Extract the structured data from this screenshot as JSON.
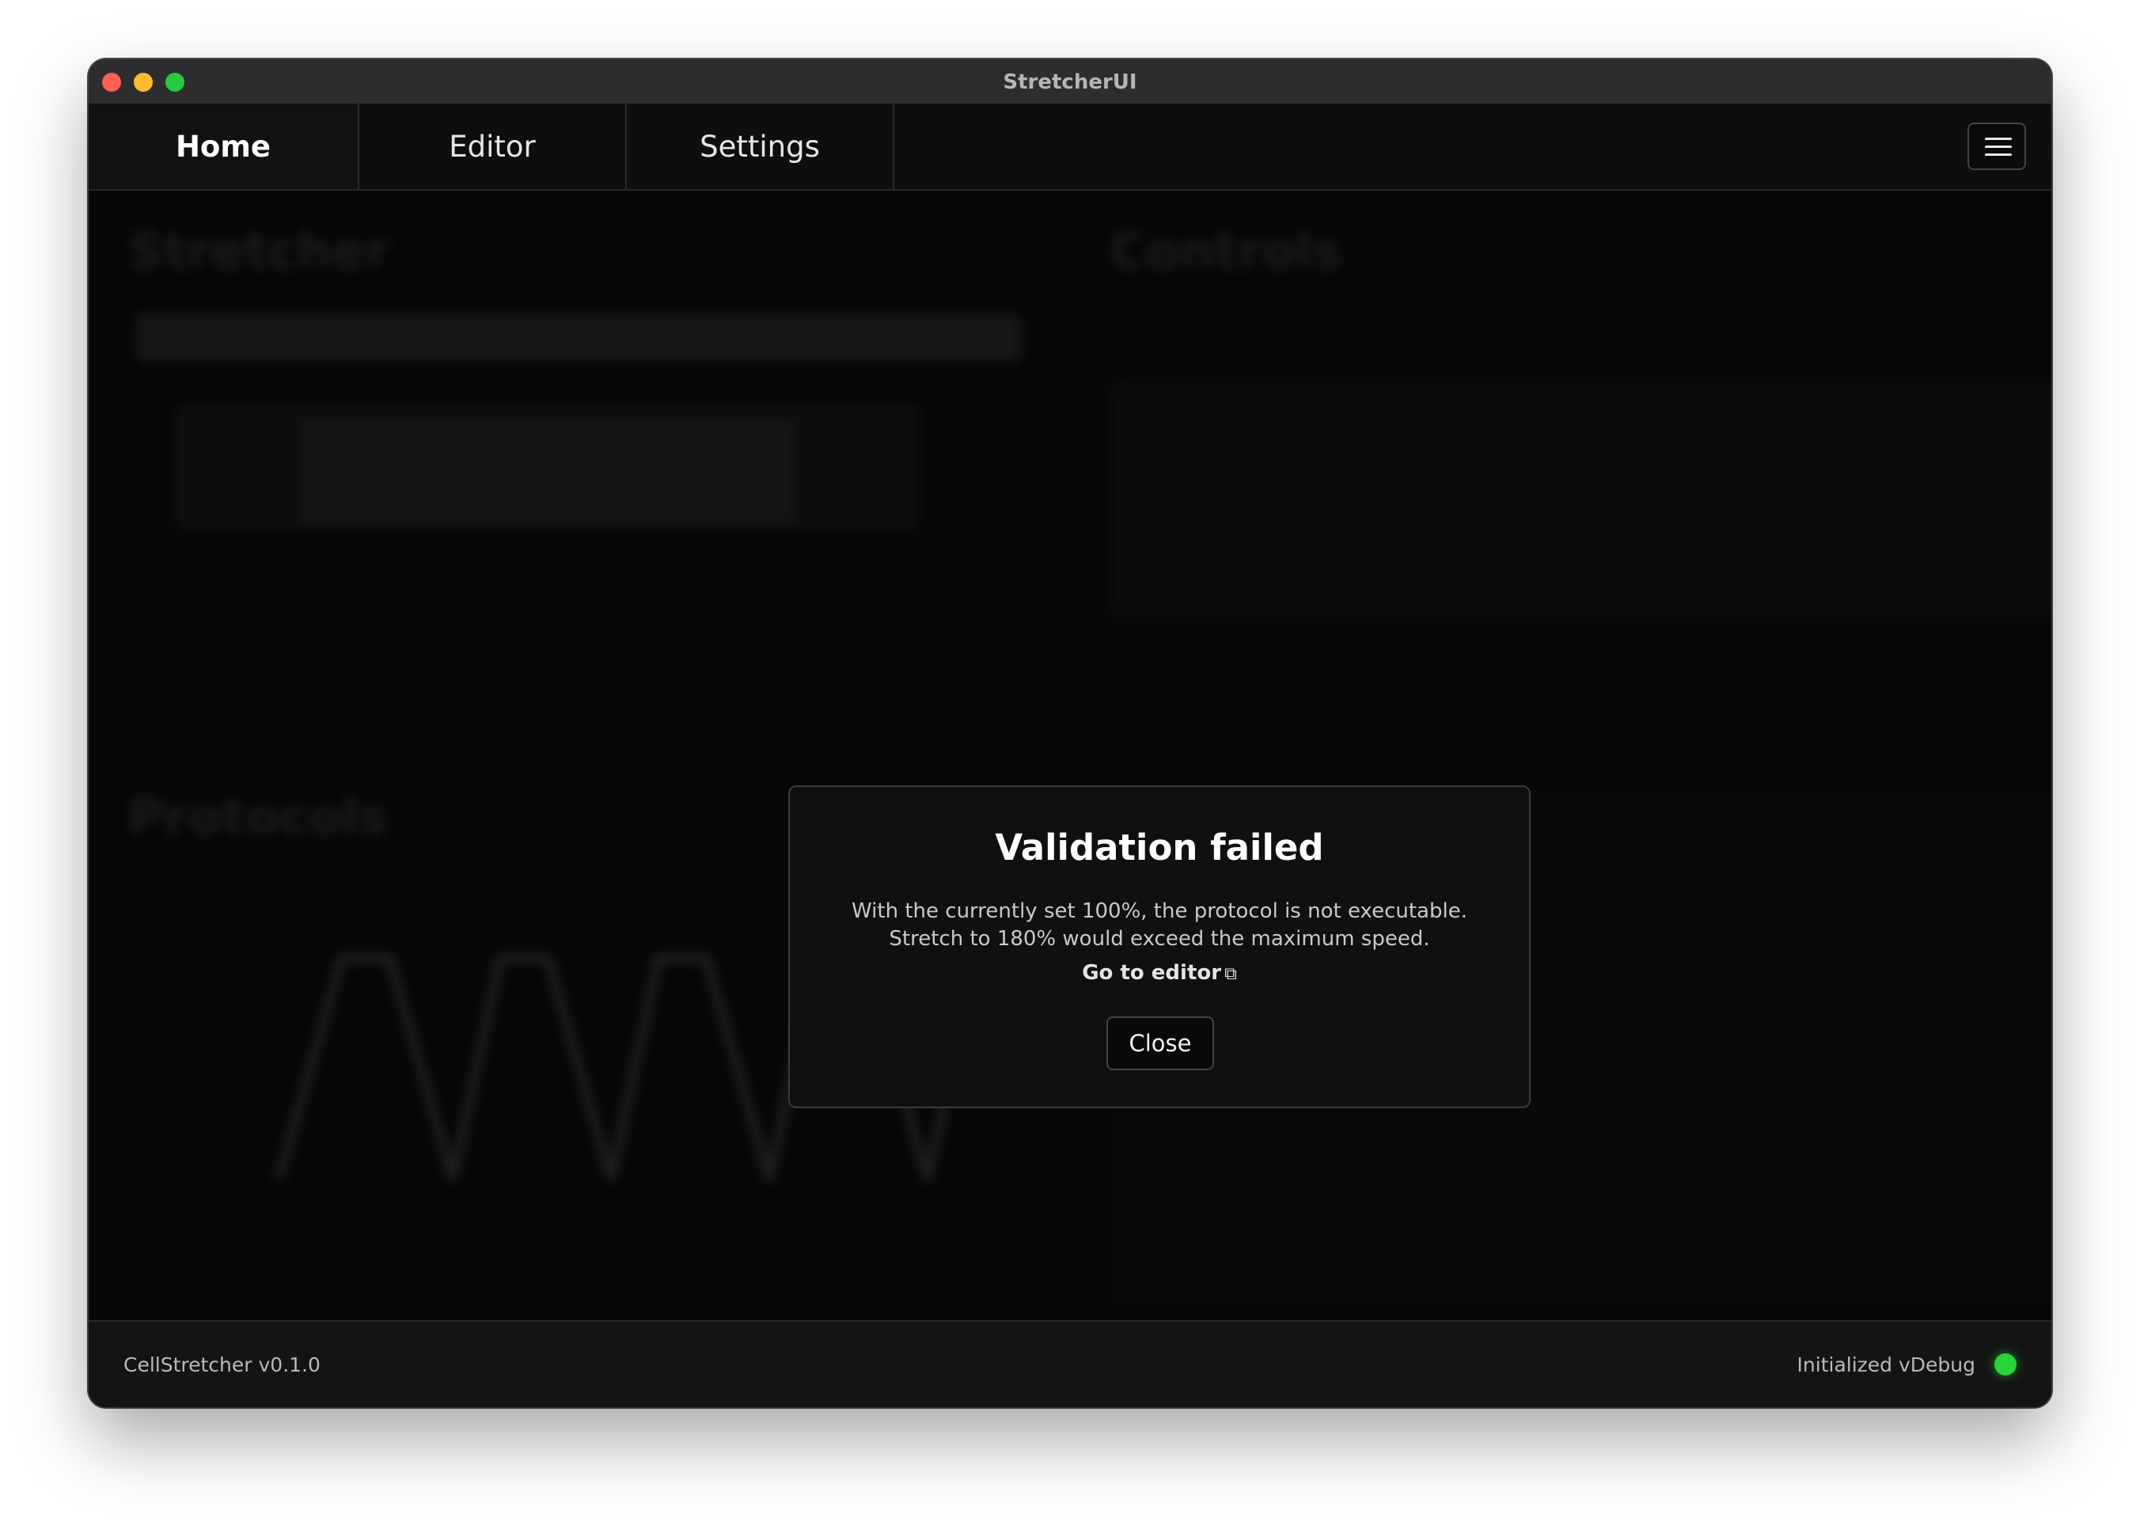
{
  "window": {
    "title": "StretcherUI"
  },
  "tabs": [
    {
      "label": "Home",
      "active": true
    },
    {
      "label": "Editor",
      "active": false
    },
    {
      "label": "Settings",
      "active": false
    }
  ],
  "menu": {
    "icon": "hamburger-icon"
  },
  "background": {
    "panels": [
      "Stretcher",
      "Controls",
      "Protocols"
    ]
  },
  "modal": {
    "title": "Validation failed",
    "line1": "With the currently set 100%, the protocol is not executable.",
    "line2": "Stretch to 180% would exceed the maximum speed.",
    "link_label": "Go to editor",
    "link_icon": "external-link-icon",
    "close_label": "Close"
  },
  "footer": {
    "app_version": "CellStretcher v0.1.0",
    "status": "Initialized vDebug",
    "status_color": "#27d43a"
  }
}
